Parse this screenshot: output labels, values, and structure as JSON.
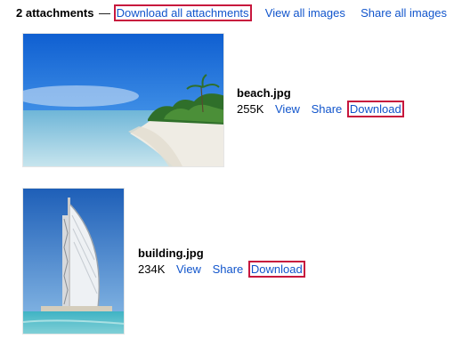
{
  "header": {
    "count_label": "2 attachments",
    "dash": "—",
    "download_all": "Download all attachments",
    "view_all": "View all images",
    "share_all": "Share all images"
  },
  "attachments": [
    {
      "filename": "beach.jpg",
      "size": "255K",
      "view": "View",
      "share": "Share",
      "download": "Download"
    },
    {
      "filename": "building.jpg",
      "size": "234K",
      "view": "View",
      "share": "Share",
      "download": "Download"
    }
  ],
  "colors": {
    "link": "#1155cc",
    "highlight": "#c7173d"
  }
}
